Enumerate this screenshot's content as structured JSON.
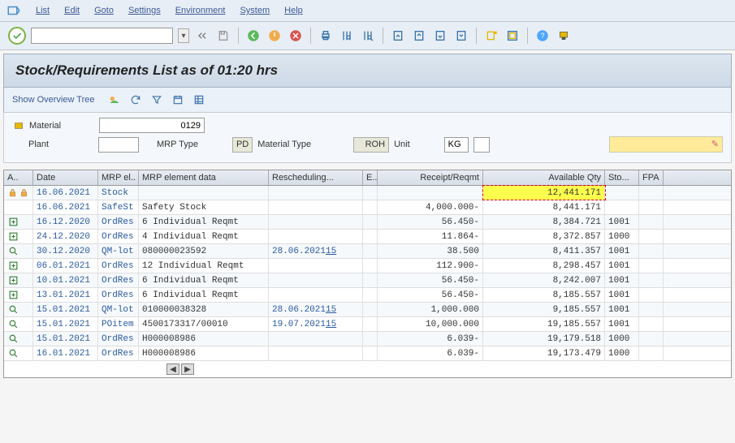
{
  "menu": [
    "List",
    "Edit",
    "Goto",
    "Settings",
    "Environment",
    "System",
    "Help"
  ],
  "search_val": "",
  "title": "Stock/Requirements List as of 01:20 hrs",
  "show_tree": "Show Overview Tree",
  "filters": {
    "material_lbl": "Material",
    "material_val": "0129",
    "plant_lbl": "Plant",
    "plant_val": "",
    "mrptype_lbl": "MRP Type",
    "mrptype_val": "PD",
    "mattype_lbl": "Material Type",
    "mattype_val": "ROH",
    "unit_lbl": "Unit",
    "unit_val": "KG"
  },
  "grid": {
    "headers": {
      "a": "A..",
      "date": "Date",
      "mrpel": "MRP el..",
      "data": "MRP element data",
      "rs": "Rescheduling...",
      "e": "E..",
      "rr": "Receipt/Reqmt",
      "av": "Available Qty",
      "sto": "Sto...",
      "fpa": "FPA"
    },
    "rows": [
      {
        "ic": "lock",
        "date": "16.06.2021",
        "mrpel": "Stock",
        "data": "",
        "rs": "",
        "e": "",
        "rr": "",
        "av": "12,441.171",
        "sto": "",
        "fpa": "",
        "hl": true
      },
      {
        "ic": "none",
        "date": "16.06.2021",
        "mrpel": "SafeSt",
        "data": "Safety Stock",
        "rs": "",
        "e": "",
        "rr": "4,000.000-",
        "av": "8,441.171",
        "sto": "",
        "fpa": ""
      },
      {
        "ic": "plus",
        "date": "16.12.2020",
        "mrpel": "OrdRes",
        "data": "6 Individual Reqmt",
        "rs": "",
        "e": "",
        "rr": "56.450-",
        "av": "8,384.721",
        "sto": "1001",
        "fpa": ""
      },
      {
        "ic": "plus",
        "date": "24.12.2020",
        "mrpel": "OrdRes",
        "data": "4 Individual Reqmt",
        "rs": "",
        "e": "",
        "rr": "11.864-",
        "av": "8,372.857",
        "sto": "1000",
        "fpa": ""
      },
      {
        "ic": "mag",
        "date": "30.12.2020",
        "mrpel": "QM-lot",
        "data": "080000023592",
        "rs": "28.06.2021",
        "e": "15",
        "rr": "38.500",
        "av": "8,411.357",
        "sto": "1001",
        "fpa": ""
      },
      {
        "ic": "plus",
        "date": "06.01.2021",
        "mrpel": "OrdRes",
        "data": "12 Individual Reqmt",
        "rs": "",
        "e": "",
        "rr": "112.900-",
        "av": "8,298.457",
        "sto": "1001",
        "fpa": ""
      },
      {
        "ic": "plus",
        "date": "10.01.2021",
        "mrpel": "OrdRes",
        "data": "6 Individual Reqmt",
        "rs": "",
        "e": "",
        "rr": "56.450-",
        "av": "8,242.007",
        "sto": "1001",
        "fpa": ""
      },
      {
        "ic": "plus",
        "date": "13.01.2021",
        "mrpel": "OrdRes",
        "data": "6 Individual Reqmt",
        "rs": "",
        "e": "",
        "rr": "56.450-",
        "av": "8,185.557",
        "sto": "1001",
        "fpa": ""
      },
      {
        "ic": "mag",
        "date": "15.01.2021",
        "mrpel": "QM-lot",
        "data": "010000038328",
        "rs": "28.06.2021",
        "e": "15",
        "rr": "1,000.000",
        "av": "9,185.557",
        "sto": "1001",
        "fpa": ""
      },
      {
        "ic": "mag",
        "date": "15.01.2021",
        "mrpel": "POitem",
        "data": "4500173317/00010",
        "rs": "19.07.2021",
        "e": "15",
        "rr": "10,000.000",
        "av": "19,185.557",
        "sto": "1001",
        "fpa": ""
      },
      {
        "ic": "mag",
        "date": "15.01.2021",
        "mrpel": "OrdRes",
        "data": "H000008986",
        "rs": "",
        "e": "",
        "rr": "6.039-",
        "av": "19,179.518",
        "sto": "1000",
        "fpa": ""
      },
      {
        "ic": "mag",
        "date": "16.01.2021",
        "mrpel": "OrdRes",
        "data": "H000008986",
        "rs": "",
        "e": "",
        "rr": "6.039-",
        "av": "19,173.479",
        "sto": "1000",
        "fpa": ""
      }
    ]
  }
}
